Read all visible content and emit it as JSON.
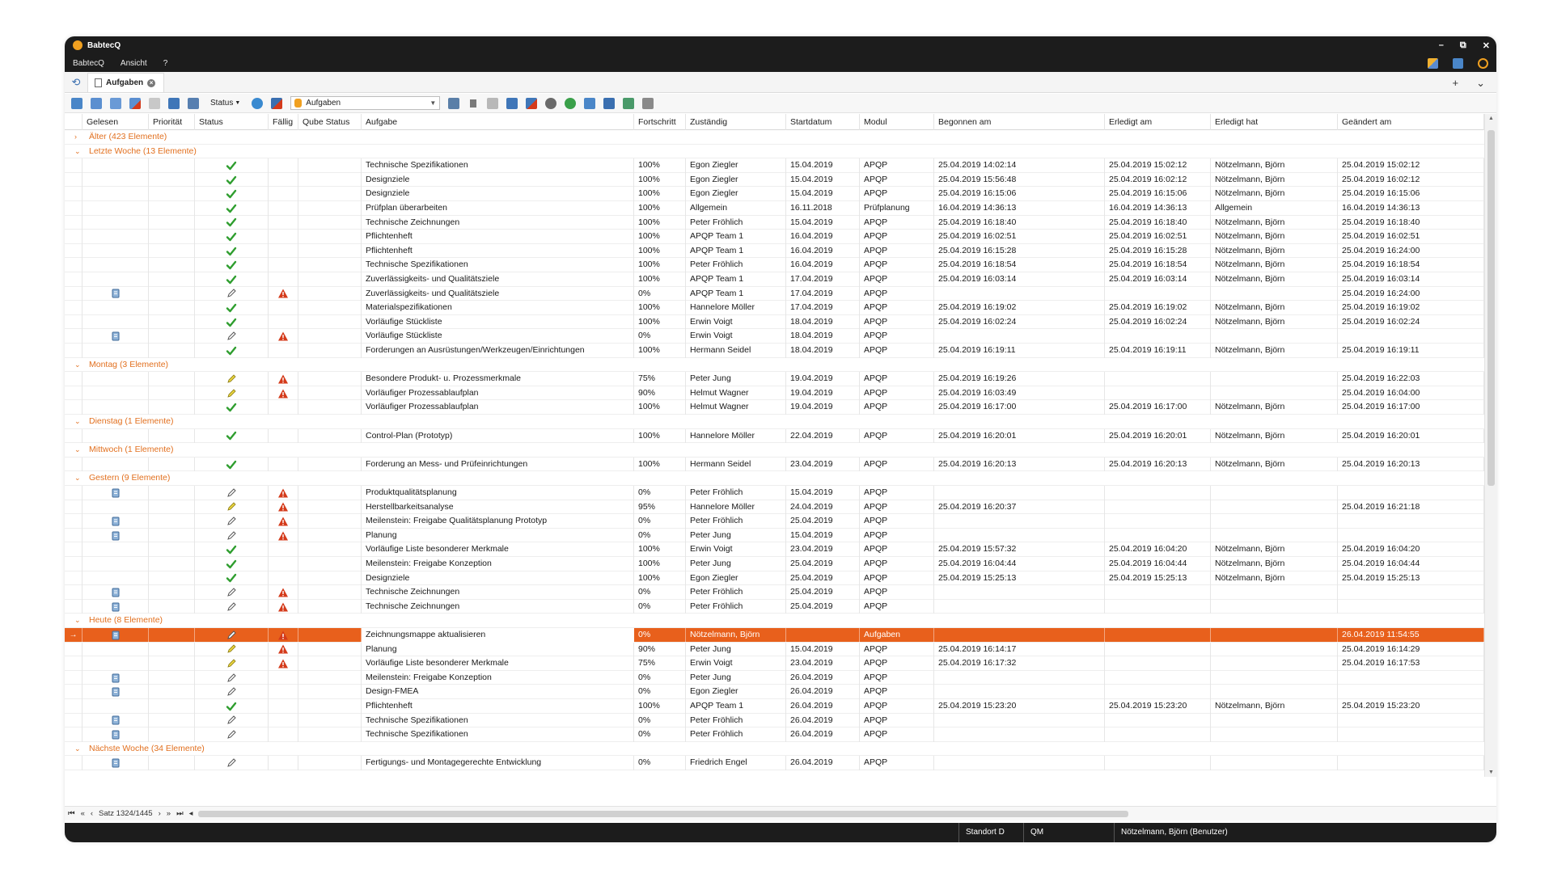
{
  "window": {
    "title": "BabtecQ",
    "controls": [
      "–",
      "⧉",
      "✕"
    ]
  },
  "menu": {
    "items": [
      "BabtecQ",
      "Ansicht",
      "?"
    ]
  },
  "tabs": {
    "home_icon": "refresh-icon",
    "active_label": "Aufgaben",
    "add": "+",
    "more": "⌄"
  },
  "toolbar": {
    "status_label": "Status",
    "view_select_value": "Aufgaben"
  },
  "columns": [
    "",
    "Gelesen",
    "Priorität",
    "Status",
    "Fällig",
    "Qube Status",
    "Aufgabe",
    "Fortschritt",
    "Zuständig",
    "Startdatum",
    "Modul",
    "Begonnen am",
    "Erledigt am",
    "Erledigt hat",
    "Geändert am"
  ],
  "rows": [
    {
      "type": "group",
      "label": "Älter (423 Elemente)",
      "collapsed": true
    },
    {
      "type": "group",
      "label": "Letzte Woche (13 Elemente)"
    },
    {
      "type": "data",
      "read": false,
      "status": "done",
      "due": false,
      "task": "Technische Spezifikationen",
      "progress": "100%",
      "owner": "Egon Ziegler",
      "start": "15.04.2019",
      "module": "APQP",
      "begun": "25.04.2019 14:02:14",
      "done_at": "25.04.2019 15:02:12",
      "done_by": "Nötzelmann, Björn",
      "changed": "25.04.2019 15:02:12"
    },
    {
      "type": "data",
      "read": false,
      "status": "done",
      "due": false,
      "task": "Designziele",
      "progress": "100%",
      "owner": "Egon Ziegler",
      "start": "15.04.2019",
      "module": "APQP",
      "begun": "25.04.2019 15:56:48",
      "done_at": "25.04.2019 16:02:12",
      "done_by": "Nötzelmann, Björn",
      "changed": "25.04.2019 16:02:12"
    },
    {
      "type": "data",
      "read": false,
      "status": "done",
      "due": false,
      "task": "Designziele",
      "progress": "100%",
      "owner": "Egon Ziegler",
      "start": "15.04.2019",
      "module": "APQP",
      "begun": "25.04.2019 16:15:06",
      "done_at": "25.04.2019 16:15:06",
      "done_by": "Nötzelmann, Björn",
      "changed": "25.04.2019 16:15:06"
    },
    {
      "type": "data",
      "read": false,
      "status": "done",
      "due": false,
      "task": "Prüfplan überarbeiten",
      "progress": "100%",
      "owner": "Allgemein",
      "start": "16.11.2018",
      "module": "Prüfplanung",
      "begun": "16.04.2019 14:36:13",
      "done_at": "16.04.2019 14:36:13",
      "done_by": "Allgemein",
      "changed": "16.04.2019 14:36:13"
    },
    {
      "type": "data",
      "read": false,
      "status": "done",
      "due": false,
      "task": "Technische Zeichnungen",
      "progress": "100%",
      "owner": "Peter Fröhlich",
      "start": "15.04.2019",
      "module": "APQP",
      "begun": "25.04.2019 16:18:40",
      "done_at": "25.04.2019 16:18:40",
      "done_by": "Nötzelmann, Björn",
      "changed": "25.04.2019 16:18:40"
    },
    {
      "type": "data",
      "read": false,
      "status": "done",
      "due": false,
      "task": "Pflichtenheft",
      "progress": "100%",
      "owner": "APQP Team 1",
      "start": "16.04.2019",
      "module": "APQP",
      "begun": "25.04.2019 16:02:51",
      "done_at": "25.04.2019 16:02:51",
      "done_by": "Nötzelmann, Björn",
      "changed": "25.04.2019 16:02:51"
    },
    {
      "type": "data",
      "read": false,
      "status": "done",
      "due": false,
      "task": "Pflichtenheft",
      "progress": "100%",
      "owner": "APQP Team 1",
      "start": "16.04.2019",
      "module": "APQP",
      "begun": "25.04.2019 16:15:28",
      "done_at": "25.04.2019 16:15:28",
      "done_by": "Nötzelmann, Björn",
      "changed": "25.04.2019 16:24:00"
    },
    {
      "type": "data",
      "read": false,
      "status": "done",
      "due": false,
      "task": "Technische Spezifikationen",
      "progress": "100%",
      "owner": "Peter Fröhlich",
      "start": "16.04.2019",
      "module": "APQP",
      "begun": "25.04.2019 16:18:54",
      "done_at": "25.04.2019 16:18:54",
      "done_by": "Nötzelmann, Björn",
      "changed": "25.04.2019 16:18:54"
    },
    {
      "type": "data",
      "read": false,
      "status": "done",
      "due": false,
      "task": "Zuverlässigkeits- und Qualitätsziele",
      "progress": "100%",
      "owner": "APQP Team 1",
      "start": "17.04.2019",
      "module": "APQP",
      "begun": "25.04.2019 16:03:14",
      "done_at": "25.04.2019 16:03:14",
      "done_by": "Nötzelmann, Björn",
      "changed": "25.04.2019 16:03:14"
    },
    {
      "type": "data",
      "read": true,
      "status": "edit",
      "due": true,
      "task": "Zuverlässigkeits- und Qualitätsziele",
      "progress": "0%",
      "owner": "APQP Team 1",
      "start": "17.04.2019",
      "module": "APQP",
      "begun": "",
      "done_at": "",
      "done_by": "",
      "changed": "25.04.2019 16:24:00"
    },
    {
      "type": "data",
      "read": false,
      "status": "done",
      "due": false,
      "task": "Materialspezifikationen",
      "progress": "100%",
      "owner": "Hannelore Möller",
      "start": "17.04.2019",
      "module": "APQP",
      "begun": "25.04.2019 16:19:02",
      "done_at": "25.04.2019 16:19:02",
      "done_by": "Nötzelmann, Björn",
      "changed": "25.04.2019 16:19:02"
    },
    {
      "type": "data",
      "read": false,
      "status": "done",
      "due": false,
      "task": "Vorläufige Stückliste",
      "progress": "100%",
      "owner": "Erwin Voigt",
      "start": "18.04.2019",
      "module": "APQP",
      "begun": "25.04.2019 16:02:24",
      "done_at": "25.04.2019 16:02:24",
      "done_by": "Nötzelmann, Björn",
      "changed": "25.04.2019 16:02:24"
    },
    {
      "type": "data",
      "read": true,
      "status": "edit",
      "due": true,
      "task": "Vorläufige Stückliste",
      "progress": "0%",
      "owner": "Erwin Voigt",
      "start": "18.04.2019",
      "module": "APQP",
      "begun": "",
      "done_at": "",
      "done_by": "",
      "changed": ""
    },
    {
      "type": "data",
      "read": false,
      "status": "done",
      "due": false,
      "task": "Forderungen an Ausrüstungen/Werkzeugen/Einrichtungen",
      "progress": "100%",
      "owner": "Hermann Seidel",
      "start": "18.04.2019",
      "module": "APQP",
      "begun": "25.04.2019 16:19:11",
      "done_at": "25.04.2019 16:19:11",
      "done_by": "Nötzelmann, Björn",
      "changed": "25.04.2019 16:19:11"
    },
    {
      "type": "group",
      "label": "Montag (3 Elemente)"
    },
    {
      "type": "data",
      "read": false,
      "status": "progress",
      "due": true,
      "task": "Besondere Produkt- u. Prozessmerkmale",
      "progress": "75%",
      "owner": "Peter Jung",
      "start": "19.04.2019",
      "module": "APQP",
      "begun": "25.04.2019 16:19:26",
      "done_at": "",
      "done_by": "",
      "changed": "25.04.2019 16:22:03"
    },
    {
      "type": "data",
      "read": false,
      "status": "progress",
      "due": true,
      "task": "Vorläufiger Prozessablaufplan",
      "progress": "90%",
      "owner": "Helmut Wagner",
      "start": "19.04.2019",
      "module": "APQP",
      "begun": "25.04.2019 16:03:49",
      "done_at": "",
      "done_by": "",
      "changed": "25.04.2019 16:04:00"
    },
    {
      "type": "data",
      "read": false,
      "status": "done",
      "due": false,
      "task": "Vorläufiger Prozessablaufplan",
      "progress": "100%",
      "owner": "Helmut Wagner",
      "start": "19.04.2019",
      "module": "APQP",
      "begun": "25.04.2019 16:17:00",
      "done_at": "25.04.2019 16:17:00",
      "done_by": "Nötzelmann, Björn",
      "changed": "25.04.2019 16:17:00"
    },
    {
      "type": "group",
      "label": "Dienstag (1 Elemente)"
    },
    {
      "type": "data",
      "read": false,
      "status": "done",
      "due": false,
      "task": "Control-Plan (Prototyp)",
      "progress": "100%",
      "owner": "Hannelore Möller",
      "start": "22.04.2019",
      "module": "APQP",
      "begun": "25.04.2019 16:20:01",
      "done_at": "25.04.2019 16:20:01",
      "done_by": "Nötzelmann, Björn",
      "changed": "25.04.2019 16:20:01"
    },
    {
      "type": "group",
      "label": "Mittwoch (1 Elemente)"
    },
    {
      "type": "data",
      "read": false,
      "status": "done",
      "due": false,
      "task": "Forderung an Mess- und Prüfeinrichtungen",
      "progress": "100%",
      "owner": "Hermann Seidel",
      "start": "23.04.2019",
      "module": "APQP",
      "begun": "25.04.2019 16:20:13",
      "done_at": "25.04.2019 16:20:13",
      "done_by": "Nötzelmann, Björn",
      "changed": "25.04.2019 16:20:13"
    },
    {
      "type": "group",
      "label": "Gestern (9 Elemente)"
    },
    {
      "type": "data",
      "read": true,
      "status": "edit",
      "due": true,
      "task": "Produktqualitätsplanung",
      "progress": "0%",
      "owner": "Peter Fröhlich",
      "start": "15.04.2019",
      "module": "APQP",
      "begun": "",
      "done_at": "",
      "done_by": "",
      "changed": ""
    },
    {
      "type": "data",
      "read": false,
      "status": "progress",
      "due": true,
      "task": "Herstellbarkeitsanalyse",
      "progress": "95%",
      "owner": "Hannelore Möller",
      "start": "24.04.2019",
      "module": "APQP",
      "begun": "25.04.2019 16:20:37",
      "done_at": "",
      "done_by": "",
      "changed": "25.04.2019 16:21:18"
    },
    {
      "type": "data",
      "read": true,
      "status": "edit",
      "due": true,
      "task": "Meilenstein: Freigabe Qualitätsplanung Prototyp",
      "progress": "0%",
      "owner": "Peter Fröhlich",
      "start": "25.04.2019",
      "module": "APQP",
      "begun": "",
      "done_at": "",
      "done_by": "",
      "changed": ""
    },
    {
      "type": "data",
      "read": true,
      "status": "edit",
      "due": true,
      "task": "Planung",
      "progress": "0%",
      "owner": "Peter Jung",
      "start": "15.04.2019",
      "module": "APQP",
      "begun": "",
      "done_at": "",
      "done_by": "",
      "changed": ""
    },
    {
      "type": "data",
      "read": false,
      "status": "done",
      "due": false,
      "task": "Vorläufige Liste besonderer Merkmale",
      "progress": "100%",
      "owner": "Erwin Voigt",
      "start": "23.04.2019",
      "module": "APQP",
      "begun": "25.04.2019 15:57:32",
      "done_at": "25.04.2019 16:04:20",
      "done_by": "Nötzelmann, Björn",
      "changed": "25.04.2019 16:04:20"
    },
    {
      "type": "data",
      "read": false,
      "status": "done",
      "due": false,
      "task": "Meilenstein: Freigabe Konzeption",
      "progress": "100%",
      "owner": "Peter Jung",
      "start": "25.04.2019",
      "module": "APQP",
      "begun": "25.04.2019 16:04:44",
      "done_at": "25.04.2019 16:04:44",
      "done_by": "Nötzelmann, Björn",
      "changed": "25.04.2019 16:04:44"
    },
    {
      "type": "data",
      "read": false,
      "status": "done",
      "due": false,
      "task": "Designziele",
      "progress": "100%",
      "owner": "Egon Ziegler",
      "start": "25.04.2019",
      "module": "APQP",
      "begun": "25.04.2019 15:25:13",
      "done_at": "25.04.2019 15:25:13",
      "done_by": "Nötzelmann, Björn",
      "changed": "25.04.2019 15:25:13"
    },
    {
      "type": "data",
      "read": true,
      "status": "edit",
      "due": true,
      "task": "Technische Zeichnungen",
      "progress": "0%",
      "owner": "Peter Fröhlich",
      "start": "25.04.2019",
      "module": "APQP",
      "begun": "",
      "done_at": "",
      "done_by": "",
      "changed": ""
    },
    {
      "type": "data",
      "read": true,
      "status": "edit",
      "due": true,
      "task": "Technische Zeichnungen",
      "progress": "0%",
      "owner": "Peter Fröhlich",
      "start": "25.04.2019",
      "module": "APQP",
      "begun": "",
      "done_at": "",
      "done_by": "",
      "changed": ""
    },
    {
      "type": "group",
      "label": "Heute (8 Elemente)"
    },
    {
      "type": "data",
      "selected": true,
      "read": true,
      "status": "edit",
      "due": true,
      "task": "Zeichnungsmappe aktualisieren",
      "progress": "0%",
      "owner": "Nötzelmann, Björn",
      "start": "",
      "module": "Aufgaben",
      "begun": "",
      "done_at": "",
      "done_by": "",
      "changed": "26.04.2019 11:54:55"
    },
    {
      "type": "data",
      "read": false,
      "status": "progress",
      "due": true,
      "task": "Planung",
      "progress": "90%",
      "owner": "Peter Jung",
      "start": "15.04.2019",
      "module": "APQP",
      "begun": "25.04.2019 16:14:17",
      "done_at": "",
      "done_by": "",
      "changed": "25.04.2019 16:14:29"
    },
    {
      "type": "data",
      "read": false,
      "status": "progress",
      "due": true,
      "task": "Vorläufige Liste besonderer Merkmale",
      "progress": "75%",
      "owner": "Erwin Voigt",
      "start": "23.04.2019",
      "module": "APQP",
      "begun": "25.04.2019 16:17:32",
      "done_at": "",
      "done_by": "",
      "changed": "25.04.2019 16:17:53"
    },
    {
      "type": "data",
      "read": true,
      "status": "edit",
      "due": false,
      "task": "Meilenstein: Freigabe Konzeption",
      "progress": "0%",
      "owner": "Peter Jung",
      "start": "26.04.2019",
      "module": "APQP",
      "begun": "",
      "done_at": "",
      "done_by": "",
      "changed": ""
    },
    {
      "type": "data",
      "read": true,
      "status": "edit",
      "due": false,
      "task": "Design-FMEA",
      "progress": "0%",
      "owner": "Egon Ziegler",
      "start": "26.04.2019",
      "module": "APQP",
      "begun": "",
      "done_at": "",
      "done_by": "",
      "changed": ""
    },
    {
      "type": "data",
      "read": false,
      "status": "done",
      "due": false,
      "task": "Pflichtenheft",
      "progress": "100%",
      "owner": "APQP Team 1",
      "start": "26.04.2019",
      "module": "APQP",
      "begun": "25.04.2019 15:23:20",
      "done_at": "25.04.2019 15:23:20",
      "done_by": "Nötzelmann, Björn",
      "changed": "25.04.2019 15:23:20"
    },
    {
      "type": "data",
      "read": true,
      "status": "edit",
      "due": false,
      "task": "Technische Spezifikationen",
      "progress": "0%",
      "owner": "Peter Fröhlich",
      "start": "26.04.2019",
      "module": "APQP",
      "begun": "",
      "done_at": "",
      "done_by": "",
      "changed": ""
    },
    {
      "type": "data",
      "read": true,
      "status": "edit",
      "due": false,
      "task": "Technische Spezifikationen",
      "progress": "0%",
      "owner": "Peter Fröhlich",
      "start": "26.04.2019",
      "module": "APQP",
      "begun": "",
      "done_at": "",
      "done_by": "",
      "changed": ""
    },
    {
      "type": "group",
      "label": "Nächste Woche (34 Elemente)"
    },
    {
      "type": "data",
      "read": true,
      "status": "edit",
      "due": false,
      "task": "Fertigungs- und Montagegerechte Entwicklung",
      "progress": "0%",
      "owner": "Friedrich Engel",
      "start": "26.04.2019",
      "module": "APQP",
      "begun": "",
      "done_at": "",
      "done_by": "",
      "changed": ""
    }
  ],
  "navigator": {
    "record_label": "Satz 1324/1445"
  },
  "statusbar": {
    "location": "Standort D",
    "module": "QM",
    "user": "Nötzelmann, Björn (Benutzer)"
  },
  "colors": {
    "accent": "#e8601c",
    "group_text": "#e2701f",
    "check": "#2f9e2f",
    "warning": "#d43a1a",
    "chrome": "#1c1c1c"
  }
}
